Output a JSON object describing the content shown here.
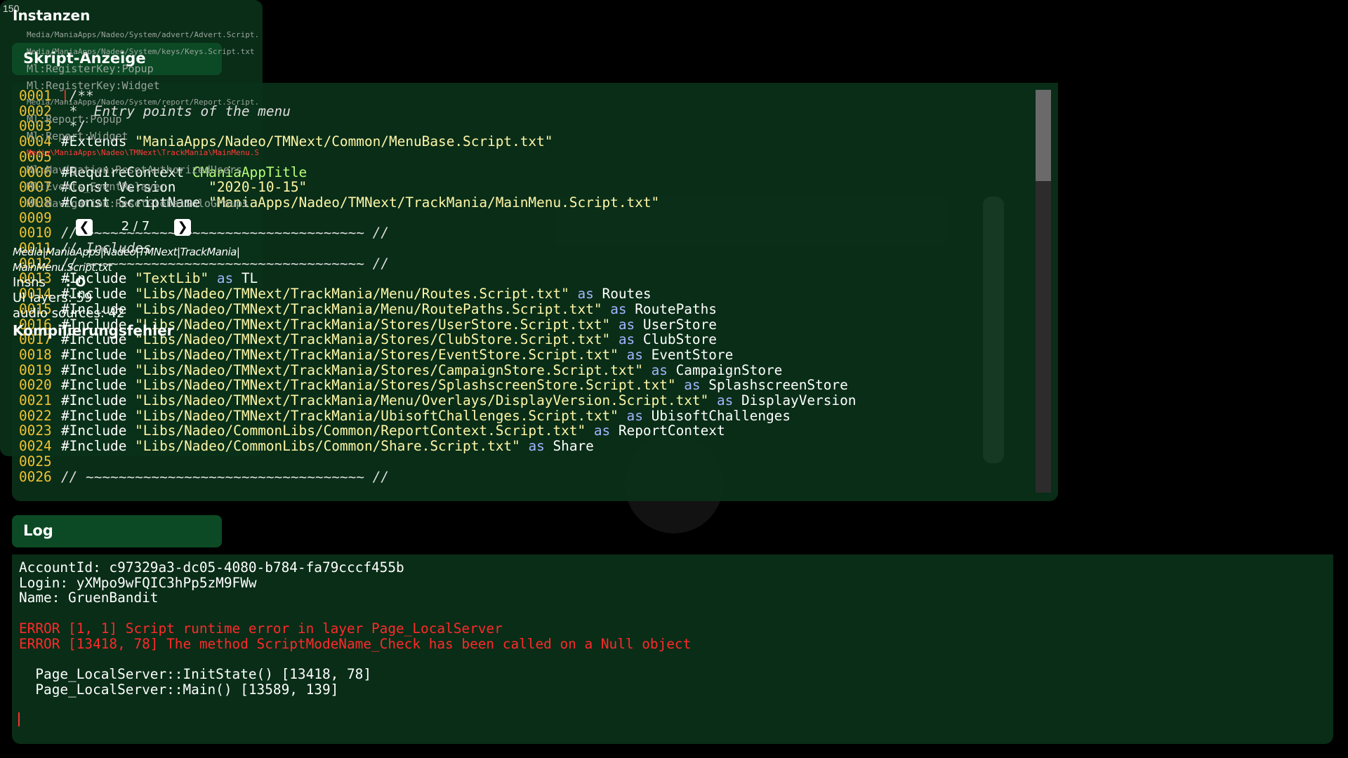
{
  "fps": "150",
  "script_panel": {
    "title": "Skript-Anzeige",
    "lines": [
      {
        "n": "0001",
        "parts": [
          {
            "t": "/**",
            "c": "cmt"
          }
        ]
      },
      {
        "n": "0002",
        "parts": [
          {
            "t": " *  Entry points of the menu",
            "c": "cmt"
          }
        ]
      },
      {
        "n": "0003",
        "parts": [
          {
            "t": " */",
            "c": "cmt"
          }
        ]
      },
      {
        "n": "0004",
        "parts": [
          {
            "t": "#Extends ",
            "c": "dir"
          },
          {
            "t": "\"ManiaApps/Nadeo/TMNext/Common/MenuBase.Script.txt\"",
            "c": "str"
          }
        ]
      },
      {
        "n": "0005",
        "parts": []
      },
      {
        "n": "0006",
        "parts": [
          {
            "t": "#RequireContext ",
            "c": "dir"
          },
          {
            "t": "CManiaAppTitle",
            "c": "cls"
          }
        ]
      },
      {
        "n": "0007",
        "parts": [
          {
            "t": "#Const Version    ",
            "c": "dir"
          },
          {
            "t": "\"2020-10-15\"",
            "c": "str"
          }
        ]
      },
      {
        "n": "0008",
        "parts": [
          {
            "t": "#Const ScriptName ",
            "c": "dir"
          },
          {
            "t": "\"ManiaApps/Nadeo/TMNext/TrackMania/MainMenu.Script.txt\"",
            "c": "str"
          }
        ]
      },
      {
        "n": "0009",
        "parts": []
      },
      {
        "n": "0010",
        "parts": [
          {
            "t": "// ~~~~~~~~~~~~~~~~~~~~~~~~~~~~~~~~~~ //",
            "c": "cmt"
          }
        ]
      },
      {
        "n": "0011",
        "parts": [
          {
            "t": "// Includes",
            "c": "cmt"
          }
        ]
      },
      {
        "n": "0012",
        "parts": [
          {
            "t": "// ~~~~~~~~~~~~~~~~~~~~~~~~~~~~~~~~~~ //",
            "c": "cmt"
          }
        ]
      },
      {
        "n": "0013",
        "parts": [
          {
            "t": "#Include ",
            "c": "dir"
          },
          {
            "t": "\"TextLib\"",
            "c": "str"
          },
          {
            "t": " as ",
            "c": "as"
          },
          {
            "t": "TL",
            "c": "dir"
          }
        ]
      },
      {
        "n": "0014",
        "parts": [
          {
            "t": "#Include ",
            "c": "dir"
          },
          {
            "t": "\"Libs/Nadeo/TMNext/TrackMania/Menu/Routes.Script.txt\"",
            "c": "str"
          },
          {
            "t": " as ",
            "c": "as"
          },
          {
            "t": "Routes",
            "c": "dir"
          }
        ]
      },
      {
        "n": "0015",
        "parts": [
          {
            "t": "#Include ",
            "c": "dir"
          },
          {
            "t": "\"Libs/Nadeo/TMNext/TrackMania/Menu/RoutePaths.Script.txt\"",
            "c": "str"
          },
          {
            "t": " as ",
            "c": "as"
          },
          {
            "t": "RoutePaths",
            "c": "dir"
          }
        ]
      },
      {
        "n": "0016",
        "parts": [
          {
            "t": "#Include ",
            "c": "dir"
          },
          {
            "t": "\"Libs/Nadeo/TMNext/TrackMania/Stores/UserStore.Script.txt\"",
            "c": "str"
          },
          {
            "t": " as ",
            "c": "as"
          },
          {
            "t": "UserStore",
            "c": "dir"
          }
        ]
      },
      {
        "n": "0017",
        "parts": [
          {
            "t": "#Include ",
            "c": "dir"
          },
          {
            "t": "\"Libs/Nadeo/TMNext/TrackMania/Stores/ClubStore.Script.txt\"",
            "c": "str"
          },
          {
            "t": " as ",
            "c": "as"
          },
          {
            "t": "ClubStore",
            "c": "dir"
          }
        ]
      },
      {
        "n": "0018",
        "parts": [
          {
            "t": "#Include ",
            "c": "dir"
          },
          {
            "t": "\"Libs/Nadeo/TMNext/TrackMania/Stores/EventStore.Script.txt\"",
            "c": "str"
          },
          {
            "t": " as ",
            "c": "as"
          },
          {
            "t": "EventStore",
            "c": "dir"
          }
        ]
      },
      {
        "n": "0019",
        "parts": [
          {
            "t": "#Include ",
            "c": "dir"
          },
          {
            "t": "\"Libs/Nadeo/TMNext/TrackMania/Stores/CampaignStore.Script.txt\"",
            "c": "str"
          },
          {
            "t": " as ",
            "c": "as"
          },
          {
            "t": "CampaignStore",
            "c": "dir"
          }
        ]
      },
      {
        "n": "0020",
        "parts": [
          {
            "t": "#Include ",
            "c": "dir"
          },
          {
            "t": "\"Libs/Nadeo/TMNext/TrackMania/Stores/SplashscreenStore.Script.txt\"",
            "c": "str"
          },
          {
            "t": " as ",
            "c": "as"
          },
          {
            "t": "SplashscreenStore",
            "c": "dir"
          }
        ]
      },
      {
        "n": "0021",
        "parts": [
          {
            "t": "#Include ",
            "c": "dir"
          },
          {
            "t": "\"Libs/Nadeo/TMNext/TrackMania/Menu/Overlays/DisplayVersion.Script.txt\"",
            "c": "str"
          },
          {
            "t": " as ",
            "c": "as"
          },
          {
            "t": "DisplayVersion",
            "c": "dir"
          }
        ]
      },
      {
        "n": "0022",
        "parts": [
          {
            "t": "#Include ",
            "c": "dir"
          },
          {
            "t": "\"Libs/Nadeo/TMNext/TrackMania/UbisoftChallenges.Script.txt\"",
            "c": "str"
          },
          {
            "t": " as ",
            "c": "as"
          },
          {
            "t": "UbisoftChallenges",
            "c": "dir"
          }
        ]
      },
      {
        "n": "0023",
        "parts": [
          {
            "t": "#Include ",
            "c": "dir"
          },
          {
            "t": "\"Libs/Nadeo/CommonLibs/Common/ReportContext.Script.txt\"",
            "c": "str"
          },
          {
            "t": " as ",
            "c": "as"
          },
          {
            "t": "ReportContext",
            "c": "dir"
          }
        ]
      },
      {
        "n": "0024",
        "parts": [
          {
            "t": "#Include ",
            "c": "dir"
          },
          {
            "t": "\"Libs/Nadeo/CommonLibs/Common/Share.Script.txt\"",
            "c": "str"
          },
          {
            "t": " as ",
            "c": "as"
          },
          {
            "t": "Share",
            "c": "dir"
          }
        ]
      },
      {
        "n": "0025",
        "parts": []
      },
      {
        "n": "0026",
        "parts": [
          {
            "t": "// ~~~~~~~~~~~~~~~~~~~~~~~~~~~~~~~~~~ //",
            "c": "cmt"
          }
        ]
      }
    ],
    "scroll_fraction": 0.22
  },
  "instances": {
    "title": "Instanzen",
    "items": [
      {
        "label": "Media/ManiaApps/Nadeo/System/advert/Advert.Script.txt",
        "size": "small",
        "active": false
      },
      {
        "label": "Media/ManiaApps/Nadeo/System/keys/Keys.Script.txt",
        "size": "small",
        "active": false
      },
      {
        "label": "Ml:RegisterKey:Popup",
        "size": "norm",
        "active": false
      },
      {
        "label": "Ml:RegisterKey:Widget",
        "size": "norm",
        "active": false
      },
      {
        "label": "Media/ManiaApps/Nadeo/System/report/Report.Script.txt",
        "size": "small",
        "active": false
      },
      {
        "label": "Ml:Report:Popup",
        "size": "norm",
        "active": false
      },
      {
        "label": "Ml:Report:Widget",
        "size": "norm",
        "active": false
      },
      {
        "label": "Media\\ManiaApps\\Nadeo\\TMNext\\TrackMania\\MainMenu.Script.txt",
        "size": "small",
        "active": true
      },
      {
        "label": "Ml:Navigation:ResetAuthorizedUsers",
        "size": "norm",
        "active": false
      },
      {
        "label": "Ml:Events_EventRelayer",
        "size": "norm",
        "active": false
      },
      {
        "label": "Ml:Navigation:ResetGlobalSoloGroups",
        "size": "norm",
        "active": false
      }
    ],
    "active_arrow": "❯",
    "pager": {
      "prev": "❮",
      "next": "❯",
      "label": "2 / 7"
    },
    "selected_path_line1": "Media|ManiaApps|Nadeo|TMNext|TrackMania|",
    "selected_path_line2": "MainMenu.Script.txt",
    "insns_label": "Insns",
    "insns_value": ": O",
    "ui_layers": "UI layers: 59",
    "audio_sources": "audio sources: 42",
    "compile_error": "Kompilierungsfehler"
  },
  "log_panel": {
    "title": "Log",
    "lines": [
      {
        "t": "AccountId: c97329a3-dc05-4080-b784-fa79cccf455b",
        "c": ""
      },
      {
        "t": "Login: yXMpo9wFQIC3hPp5zM9FWw",
        "c": ""
      },
      {
        "t": "Name: GruenBandit",
        "c": ""
      },
      {
        "t": "",
        "c": ""
      },
      {
        "t": "ERROR [1, 1] Script runtime error in layer Page_LocalServer",
        "c": "err"
      },
      {
        "t": "ERROR [13418, 78] The method ScriptModeName_Check has been called on a Null object",
        "c": "err"
      },
      {
        "t": "",
        "c": ""
      },
      {
        "t": "  Page_LocalServer::InitState() [13418, 78]",
        "c": ""
      },
      {
        "t": "  Page_LocalServer::Main() [13589, 139]",
        "c": ""
      }
    ]
  },
  "colors": {
    "panel_bg": "#0a3019",
    "tab_bg": "#0b4a24",
    "line_number": "#f1c232",
    "string": "#fff6a8",
    "as_keyword": "#9fb6ff",
    "class": "#b9ff7a",
    "error": "#ff2a2a"
  }
}
